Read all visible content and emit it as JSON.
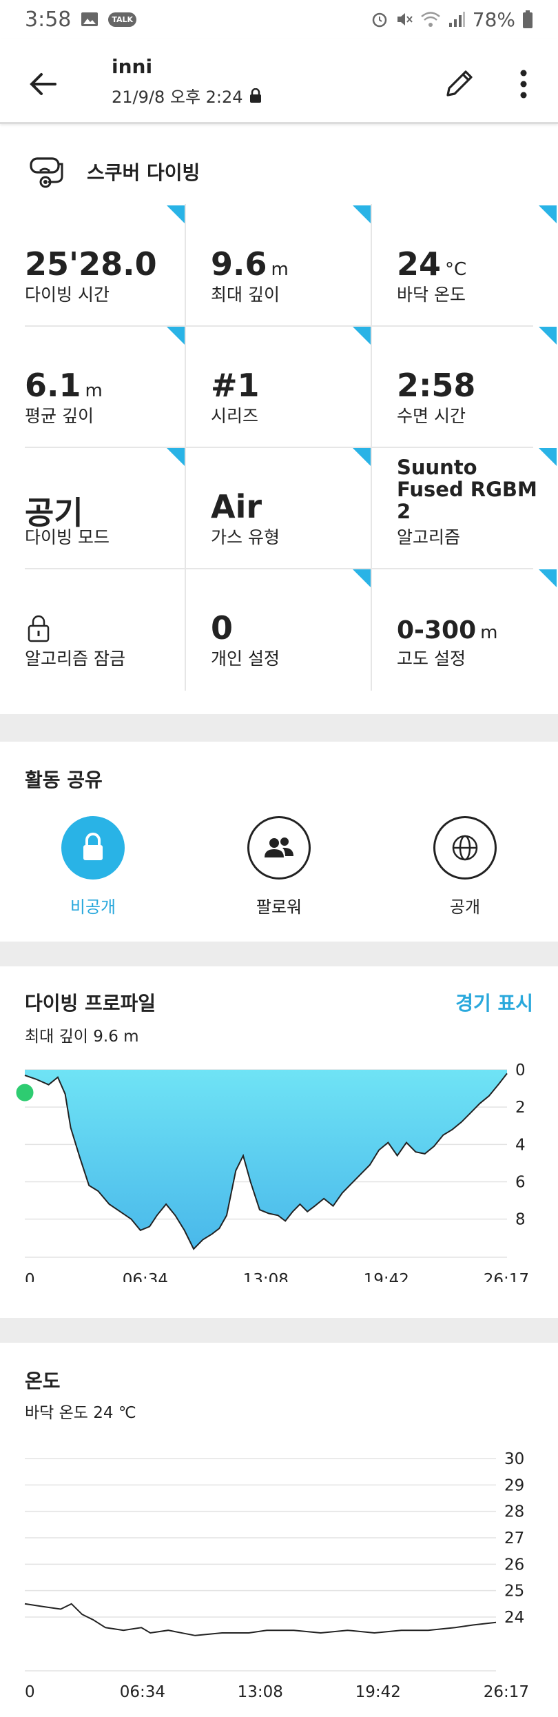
{
  "status_bar": {
    "time": "3:58",
    "battery": "78%"
  },
  "header": {
    "title": "inni",
    "subtitle": "21/9/8 오후 2:24"
  },
  "activity": {
    "label": "스쿠버 다이빙"
  },
  "stats": [
    {
      "value": "25'28.0",
      "unit": "",
      "label": "다이빙 시간"
    },
    {
      "value": "9.6",
      "unit": "m",
      "label": "최대 깊이"
    },
    {
      "value": "24",
      "unit": "°C",
      "label": "바닥 온도"
    },
    {
      "value": "6.1",
      "unit": "m",
      "label": "평균 깊이"
    },
    {
      "value": "#1",
      "unit": "",
      "label": "시리즈"
    },
    {
      "value": "2:58",
      "unit": "",
      "label": "수면 시간"
    },
    {
      "value": "공기",
      "unit": "",
      "label": "다이빙 모드"
    },
    {
      "value": "Air",
      "unit": "",
      "label": "가스 유형"
    },
    {
      "value": "Suunto Fused RGBM 2",
      "unit": "",
      "label": "알고리즘"
    },
    {
      "value": "",
      "unit": "",
      "label": "알고리즘 잠금"
    },
    {
      "value": "0",
      "unit": "",
      "label": "개인 설정"
    },
    {
      "value": "0-300",
      "unit": "m",
      "label": "고도 설정"
    }
  ],
  "share": {
    "title": "활동 공유",
    "options": [
      {
        "label": "비공개",
        "selected": true
      },
      {
        "label": "팔로워",
        "selected": false
      },
      {
        "label": "공개",
        "selected": false
      }
    ]
  },
  "colors": {
    "accent": "#29b3e6",
    "link": "#29a8dc",
    "depth_fill_top": "#6fe3f5",
    "depth_fill_bottom": "#49b8ea",
    "start_dot": "#2ecc71"
  },
  "profile": {
    "title": "다이빙 프로파일",
    "link": "경기 표시",
    "subtitle": "최대 깊이 9.6 m"
  },
  "temperature": {
    "title": "온도",
    "subtitle": "바닥 온도 24 ℃"
  },
  "chart_data": [
    {
      "type": "area",
      "x_tick_labels": [
        "0",
        "06:34",
        "13:08",
        "19:42",
        "26:17"
      ],
      "y_tick_labels": [
        "0",
        "2",
        "4",
        "6",
        "8"
      ],
      "ylim": [
        0,
        9.6
      ],
      "y_inverted": true,
      "x_minutes": [
        0,
        0.6,
        1.3,
        1.8,
        2.2,
        2.5,
        3.0,
        3.5,
        4.0,
        4.6,
        5.2,
        5.8,
        6.3,
        6.8,
        7.2,
        7.7,
        8.2,
        8.7,
        9.2,
        9.7,
        10.2,
        10.6,
        11.0,
        11.5,
        11.9,
        12.3,
        12.8,
        13.3,
        13.8,
        14.2,
        14.6,
        15.0,
        15.4,
        15.8,
        16.3,
        16.8,
        17.3,
        17.8,
        18.3,
        18.8,
        19.3,
        19.8,
        20.3,
        20.8,
        21.3,
        21.8,
        22.3,
        22.8,
        23.3,
        23.8,
        24.3,
        24.8,
        25.3,
        25.8,
        26.28
      ],
      "depth_m": [
        0.3,
        0.5,
        0.8,
        0.4,
        1.3,
        3.1,
        4.7,
        6.2,
        6.5,
        7.2,
        7.6,
        8.0,
        8.6,
        8.4,
        7.8,
        7.2,
        7.8,
        8.6,
        9.6,
        9.1,
        8.8,
        8.5,
        7.8,
        5.4,
        4.6,
        6.0,
        7.5,
        7.7,
        7.8,
        8.1,
        7.6,
        7.2,
        7.6,
        7.3,
        6.9,
        7.3,
        6.6,
        6.1,
        5.6,
        5.1,
        4.3,
        3.9,
        4.6,
        3.9,
        4.4,
        4.5,
        4.1,
        3.5,
        3.2,
        2.8,
        2.3,
        1.8,
        1.4,
        0.8,
        0.2
      ]
    },
    {
      "type": "line",
      "x_tick_labels": [
        "0",
        "06:34",
        "13:08",
        "19:42",
        "26:17"
      ],
      "y_tick_labels": [
        "30",
        "29",
        "28",
        "27",
        "26",
        "25",
        "24"
      ],
      "ylim": [
        23.3,
        30
      ],
      "x_minutes": [
        0,
        1.0,
        2.0,
        2.6,
        3.2,
        3.8,
        4.5,
        5.5,
        6.5,
        7.0,
        8.0,
        9.5,
        11.0,
        12.5,
        13.5,
        15.0,
        16.5,
        18.0,
        19.5,
        21.0,
        22.5,
        24.0,
        25.0,
        26.28
      ],
      "temp_c": [
        24.5,
        24.4,
        24.3,
        24.5,
        24.1,
        23.9,
        23.6,
        23.5,
        23.6,
        23.4,
        23.5,
        23.3,
        23.4,
        23.4,
        23.5,
        23.5,
        23.4,
        23.5,
        23.4,
        23.5,
        23.5,
        23.6,
        23.7,
        23.8
      ]
    }
  ]
}
